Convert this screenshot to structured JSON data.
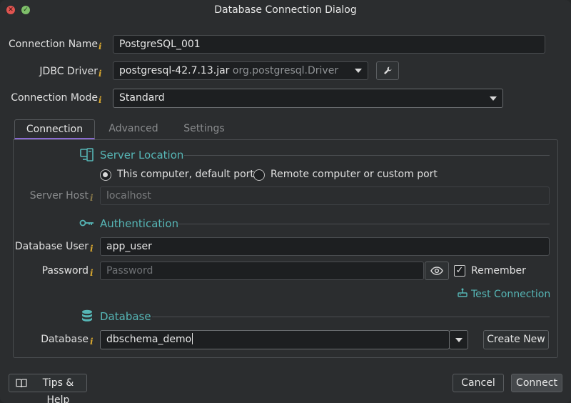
{
  "window": {
    "title": "Database Connection Dialog"
  },
  "form": {
    "connection_name_label": "Connection Name",
    "connection_name_value": "PostgreSQL_001",
    "jdbc_driver_label": "JDBC Driver",
    "jdbc_driver_value": "postgresql-42.7.13.jar",
    "jdbc_driver_class": "org.postgresql.Driver",
    "connection_mode_label": "Connection Mode",
    "connection_mode_value": "Standard"
  },
  "tabs": [
    {
      "label": "Connection",
      "active": true
    },
    {
      "label": "Advanced",
      "active": false
    },
    {
      "label": "Settings",
      "active": false
    }
  ],
  "server_location": {
    "title": "Server Location",
    "option_local": "This computer, default port",
    "option_remote": "Remote computer or custom port",
    "selected": "local",
    "host_label": "Server Host",
    "host_value": "localhost"
  },
  "authentication": {
    "title": "Authentication",
    "user_label": "Database User",
    "user_value": "app_user",
    "password_label": "Password",
    "password_placeholder": "Password",
    "remember_label": "Remember",
    "remember_checked": true,
    "test_connection_label": "Test Connection"
  },
  "database": {
    "title": "Database",
    "label": "Database",
    "value": "dbschema_demo",
    "create_new_label": "Create New"
  },
  "footer": {
    "tips_label": "Tips & Help",
    "cancel_label": "Cancel",
    "connect_label": "Connect"
  },
  "colors": {
    "accent": "#56b6b6",
    "info": "#d9a82f",
    "tab_underline": "#8a6bd1"
  }
}
